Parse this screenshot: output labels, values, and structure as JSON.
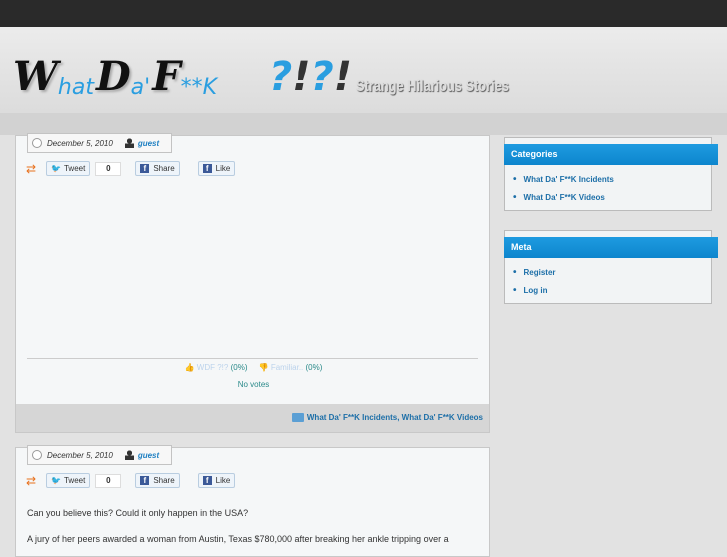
{
  "site": {
    "logo_text": "WhatDa'F**K ?!?!",
    "tagline": "Strange Hilarious Stories"
  },
  "posts": [
    {
      "date": "December 5, 2010",
      "author": "guest",
      "tweet": "Tweet",
      "tweet_count": "0",
      "share": "Share",
      "like": "Like",
      "vote_up_label": "WDF ?!?",
      "vote_up_pct": "(0%)",
      "vote_down_label": "Familiar..",
      "vote_down_pct": "(0%)",
      "vote_status": "No votes",
      "categories": "What Da' F**K Incidents, What Da' F**K Videos"
    },
    {
      "date": "December 5, 2010",
      "author": "guest",
      "tweet": "Tweet",
      "tweet_count": "0",
      "share": "Share",
      "like": "Like",
      "paragraphs": [
        "Can you believe this? Could it only happen in the USA?",
        "A jury of her peers awarded a woman from Austin, Texas $780,000 after breaking her ankle tripping over a"
      ]
    }
  ],
  "sidebar": {
    "categories": {
      "title": "Categories",
      "items": [
        "What Da' F**K Incidents",
        "What Da' F**K Videos"
      ]
    },
    "meta": {
      "title": "Meta",
      "items": [
        "Register",
        "Log in"
      ]
    }
  }
}
